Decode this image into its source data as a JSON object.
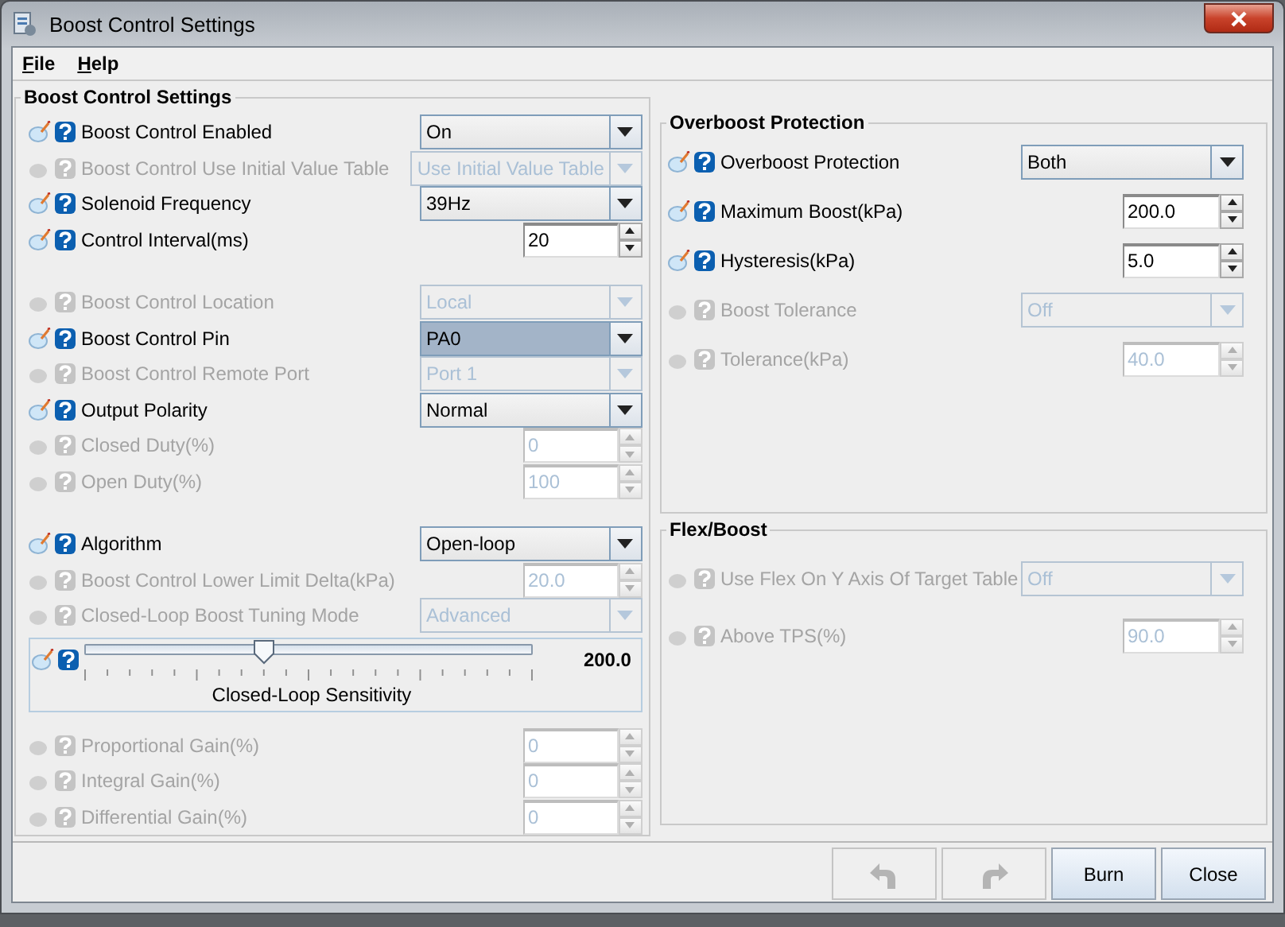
{
  "window": {
    "title": "Boost Control Settings"
  },
  "menu": [
    {
      "label": "File"
    },
    {
      "label": "Help"
    }
  ],
  "left_panel": {
    "title": "Boost Control Settings",
    "groups": [
      [
        {
          "kind": "combo",
          "label": "Boost Control Enabled",
          "value": "On",
          "disabled": false,
          "focused": false
        },
        {
          "kind": "combo",
          "label": "Boost Control Use Initial Value Table",
          "value": "Use Initial Value Table",
          "disabled": true,
          "focused": false
        },
        {
          "kind": "combo",
          "label": "Solenoid Frequency",
          "value": "39Hz",
          "disabled": false,
          "focused": false
        },
        {
          "kind": "spinner",
          "label": "Control Interval(ms)",
          "value": "20",
          "disabled": false
        }
      ],
      [
        {
          "kind": "combo",
          "label": "Boost Control Location",
          "value": "Local",
          "disabled": true,
          "focused": false
        },
        {
          "kind": "combo",
          "label": "Boost Control Pin",
          "value": "PA0",
          "disabled": false,
          "focused": true
        },
        {
          "kind": "combo",
          "label": "Boost Control Remote Port",
          "value": "Port 1",
          "disabled": true,
          "focused": false
        },
        {
          "kind": "combo",
          "label": "Output Polarity",
          "value": "Normal",
          "disabled": false,
          "focused": false
        },
        {
          "kind": "spinner",
          "label": "Closed Duty(%)",
          "value": "0",
          "disabled": true
        },
        {
          "kind": "spinner",
          "label": "Open Duty(%)",
          "value": "100",
          "disabled": true
        }
      ],
      [
        {
          "kind": "combo",
          "label": "Algorithm",
          "value": "Open-loop",
          "disabled": false,
          "focused": false
        },
        {
          "kind": "spinner",
          "label": "Boost Control Lower Limit Delta(kPa)",
          "value": "20.0",
          "disabled": true
        },
        {
          "kind": "combo",
          "label": "Closed-Loop Boost Tuning Mode",
          "value": "Advanced",
          "disabled": true,
          "focused": false
        },
        {
          "kind": "slider",
          "label": "Closed-Loop Sensitivity",
          "reading": "200.0",
          "level": 0.4,
          "disabled": false
        },
        {
          "kind": "spinner",
          "label": "Proportional Gain(%)",
          "value": "0",
          "disabled": true
        },
        {
          "kind": "spinner",
          "label": "Integral Gain(%)",
          "value": "0",
          "disabled": true
        },
        {
          "kind": "spinner",
          "label": "Differential Gain(%)",
          "value": "0",
          "disabled": true
        }
      ]
    ]
  },
  "right_panels": [
    {
      "title": "Overboost Protection",
      "rows": [
        {
          "kind": "combo",
          "label": "Overboost Protection",
          "value": "Both",
          "disabled": false,
          "focused": false
        },
        {
          "kind": "spinner",
          "label": "Maximum Boost(kPa)",
          "value": "200.0",
          "disabled": false
        },
        {
          "kind": "spinner",
          "label": "Hysteresis(kPa)",
          "value": "5.0",
          "disabled": false
        },
        {
          "kind": "combo",
          "label": "Boost Tolerance",
          "value": "Off",
          "disabled": true,
          "focused": false
        },
        {
          "kind": "spinner",
          "label": "Tolerance(kPa)",
          "value": "40.0",
          "disabled": true
        }
      ]
    },
    {
      "title": "Flex/Boost",
      "rows": [
        {
          "kind": "combo",
          "label": "Use Flex On Y Axis Of Target Table",
          "value": "Off",
          "disabled": true,
          "focused": false
        },
        {
          "kind": "spinner",
          "label": "Above TPS(%)",
          "value": "90.0",
          "disabled": true
        }
      ]
    }
  ],
  "buttons": [
    {
      "kind": "undo",
      "disabled": true
    },
    {
      "kind": "redo",
      "disabled": true
    },
    {
      "kind": "text",
      "label": "Burn",
      "disabled": false
    },
    {
      "kind": "text",
      "label": "Close",
      "disabled": false
    }
  ]
}
